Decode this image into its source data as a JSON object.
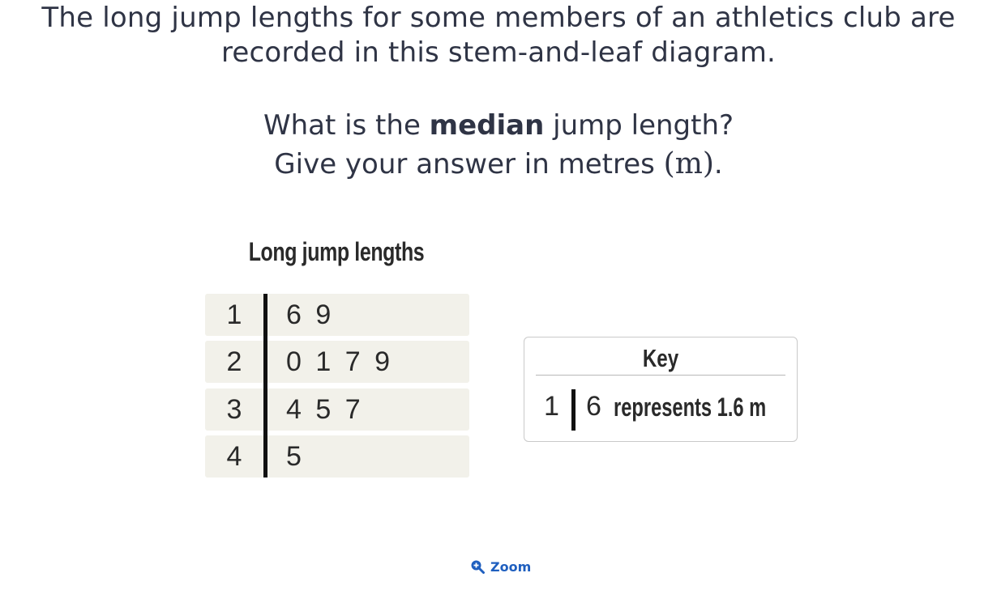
{
  "question": {
    "line1": "The long jump lengths for some members of an athletics club are",
    "line2": "recorded in this stem-and-leaf diagram.",
    "prompt_prefix": "What is the ",
    "prompt_strong": "median",
    "prompt_suffix": " jump length?",
    "instruction_prefix": "Give your answer in metres ",
    "instruction_unit": "(m)",
    "instruction_suffix": "."
  },
  "figure": {
    "title": "Long jump lengths"
  },
  "chart_data": {
    "type": "table",
    "title": "Long jump lengths",
    "rows": [
      {
        "stem": "1",
        "leaves": "6 9"
      },
      {
        "stem": "2",
        "leaves": "0 1 7 9"
      },
      {
        "stem": "3",
        "leaves": "4 5 7"
      },
      {
        "stem": "4",
        "leaves": "5"
      }
    ]
  },
  "key": {
    "title": "Key",
    "stem": "1",
    "leaf": "6",
    "text": "represents 1.6 m"
  },
  "zoom": {
    "label": "Zoom",
    "icon": "zoom-in-icon",
    "color": "#1f5fbf"
  }
}
